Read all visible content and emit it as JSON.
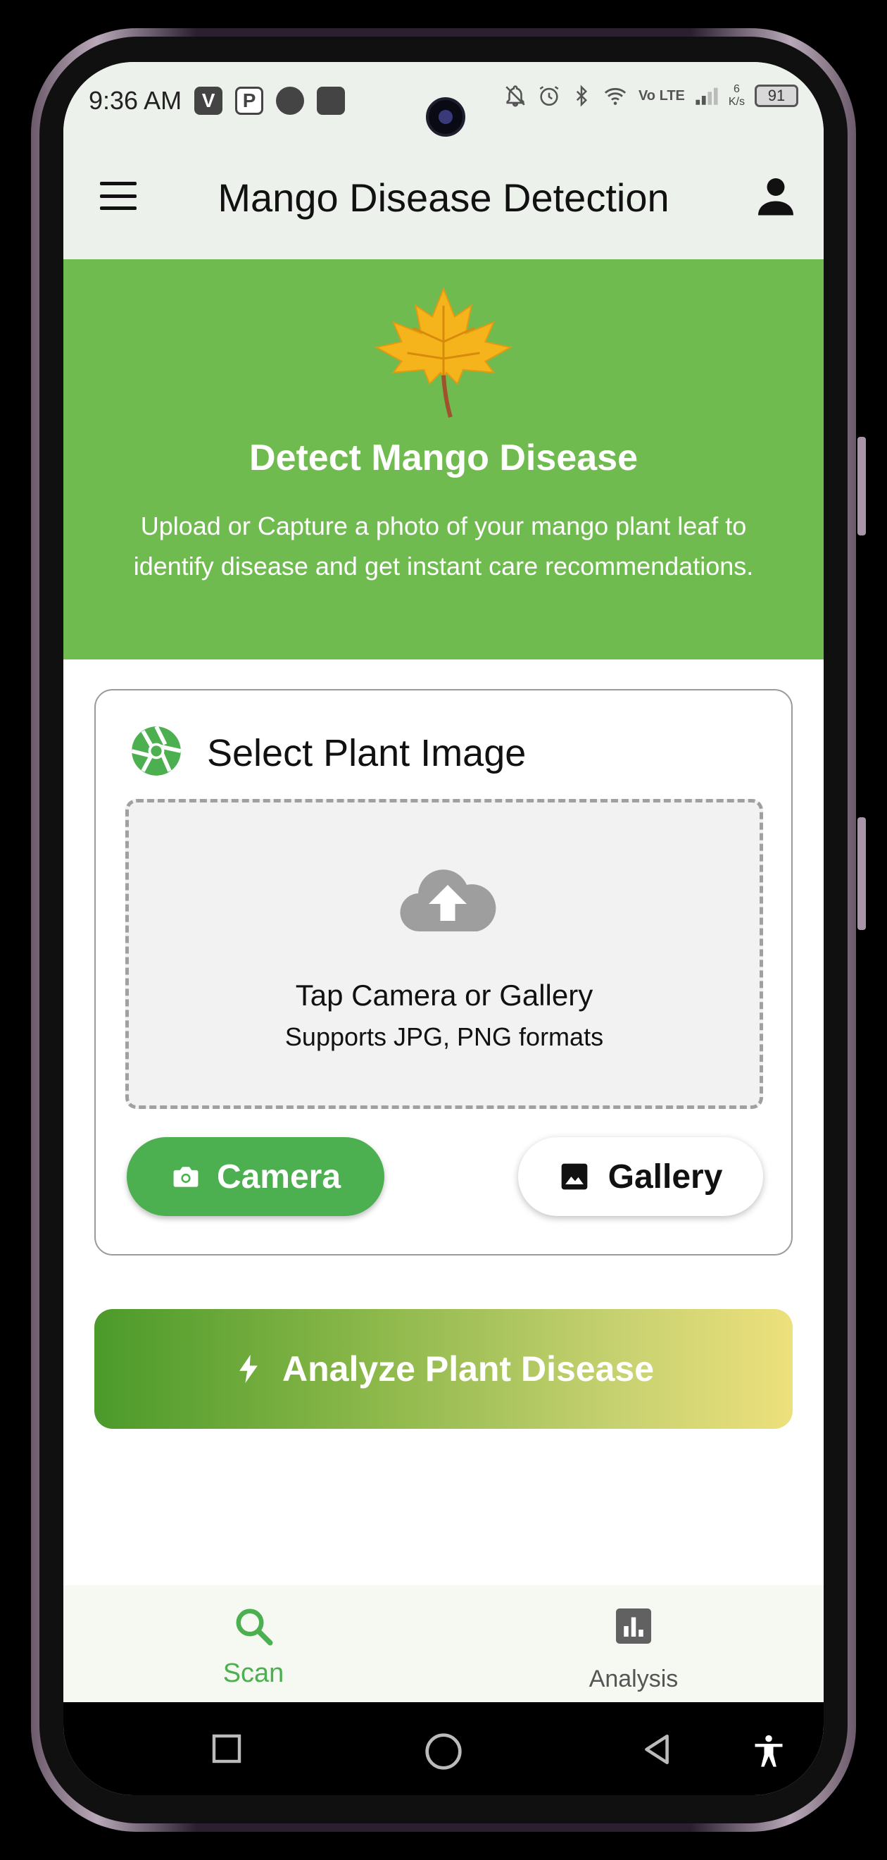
{
  "status_bar": {
    "time": "9:36 AM",
    "left_icons": [
      "V",
      "P"
    ],
    "network": "Vo LTE",
    "speed_value": "6",
    "speed_unit": "K/s",
    "battery": "91"
  },
  "app_bar": {
    "title": "Mango Disease Detection",
    "menu_icon": "menu-icon",
    "account_icon": "person-icon"
  },
  "hero": {
    "icon": "maple-leaf-icon",
    "title": "Detect Mango Disease",
    "subtitle": "Upload or Capture a photo of your mango plant leaf to identify disease and get instant care recommendations.",
    "background": "#70bb4f"
  },
  "image_card": {
    "icon": "aperture-icon",
    "title": "Select Plant Image",
    "dropzone": {
      "icon": "cloud-upload-icon",
      "title": "Tap Camera or Gallery",
      "subtitle": "Supports JPG, PNG formats"
    },
    "camera_button": "Camera",
    "gallery_button": "Gallery"
  },
  "analyze_button": {
    "icon": "bolt-icon",
    "label": "Analyze Plant Disease"
  },
  "bottom_nav": {
    "items": [
      {
        "label": "Scan",
        "icon": "search-icon",
        "active": true
      },
      {
        "label": "Analysis",
        "icon": "bar-chart-icon",
        "active": false
      }
    ]
  },
  "colors": {
    "accent": "#4caf50",
    "hero": "#70bb4f",
    "gradient_start": "#4b9a2a",
    "gradient_end": "#ece07c"
  }
}
